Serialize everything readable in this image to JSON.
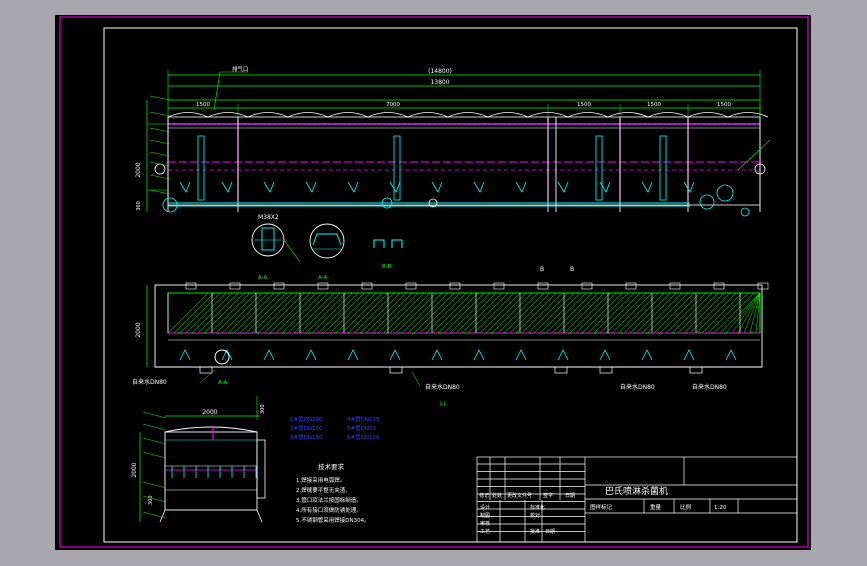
{
  "colors": {
    "background": "#a7a7ad",
    "canvas": "#000000",
    "frame": "#ff00ff",
    "border": "#ffffff",
    "geometry": "#00ffff",
    "hatch": "#00ff00",
    "dims": "#00ff00",
    "centerline": "#ff00ff",
    "text": "#ffffff",
    "notes": "#0000ff",
    "yellow": "#ffff00"
  },
  "front_view": {
    "label_exhaust": "排气口",
    "overall_dim_paren": "(14800)",
    "overall_dim": "13800",
    "segments": [
      "1500",
      "7000",
      "1500",
      "1500",
      "1500"
    ],
    "height_dim": "2000",
    "base_dim": "360"
  },
  "sections": {
    "detail_label": "M38X2",
    "section_a": "A-A",
    "section_b": "B-B",
    "section_b_marker": "B",
    "plan_view_label": "I-I"
  },
  "plan_view": {
    "side_dim": "2000",
    "pipe_labels": [
      "自来水DN80",
      "自来水DN80",
      "自来水DN80",
      "自来水DN80"
    ]
  },
  "side_view": {
    "width_dim": "2000",
    "height_dim": "2000",
    "small_dim": "300",
    "bottom_dim": "300"
  },
  "legend": [
    "1#管DN200",
    "2#管DN150",
    "3#管DN150",
    "4#管DN125",
    "5#管DN50",
    "6#管DN100"
  ],
  "notes": {
    "title": "技术要求",
    "items": [
      "1.焊接采用电弧焊。",
      "2.焊缝要平整无夹渣。",
      "3.管口及法兰按国标制造。",
      "4.所有接口须做防锈处理。",
      "5.不锈钢管采用焊接DN304。"
    ]
  },
  "title_block": {
    "title": "巴氏喷淋杀菌机",
    "drawing_mark": "图样标记",
    "weight": "重量",
    "scale": "比例",
    "scale_value": "1:20",
    "col_marks": "标记",
    "col_count": "处数",
    "col_file": "更改文件号",
    "col_sign": "签字",
    "col_date": "日期",
    "design": "设计",
    "standardization": "标准化",
    "drafting": "制图",
    "review": "审核",
    "check": "校对",
    "process": "工艺",
    "approve": "批准",
    "date_label": "日期"
  }
}
